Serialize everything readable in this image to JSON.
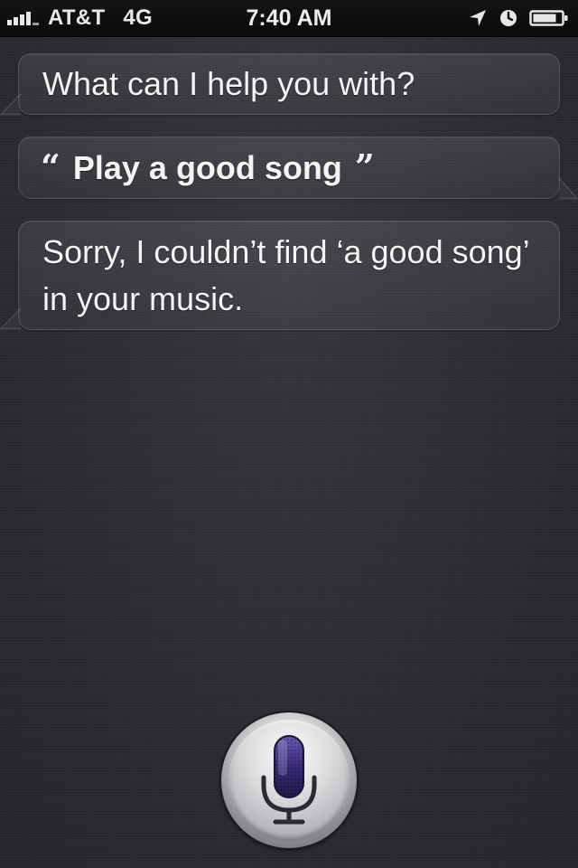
{
  "status_bar": {
    "carrier": "AT&T",
    "network": "4G",
    "time": "7:40 AM",
    "icons": [
      "signal-bars-icon",
      "location-arrow-icon",
      "alarm-clock-icon",
      "battery-icon"
    ]
  },
  "conversation": [
    {
      "speaker": "assistant",
      "text": "What can I help you with?"
    },
    {
      "speaker": "user",
      "open_quote": "“",
      "text": "Play a good song",
      "close_quote": "”"
    },
    {
      "speaker": "assistant",
      "text": "Sorry, I couldn’t find ‘a good song’ in your music."
    }
  ],
  "mic_button": {
    "icon": "microphone-icon",
    "accent_color": "#3a2a78"
  },
  "colors": {
    "background": "#2b2c31",
    "status_bar": "#0d0d0e",
    "text": "#f4f4f4"
  }
}
